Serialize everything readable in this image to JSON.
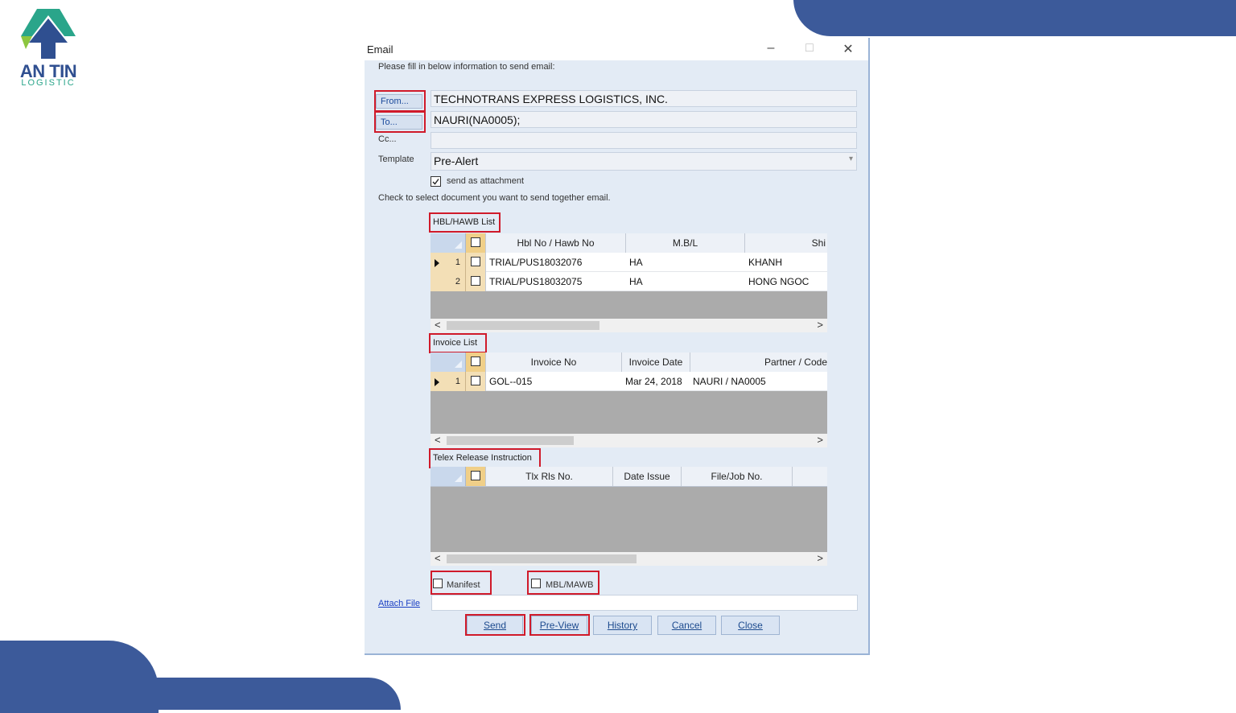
{
  "brand": {
    "name": "AN TIN",
    "tagline": "LOGISTIC",
    "accent": "#3c5a9a",
    "green": "#2aa58a"
  },
  "window": {
    "title": "Email",
    "minimize": "–",
    "maximize": "□",
    "close": "✕"
  },
  "form": {
    "instruction": "Please fill in below information to send email:",
    "from_label": "From...",
    "from_value": "TECHNOTRANS EXPRESS LOGISTICS, INC.",
    "to_label": "To...",
    "to_value": "NAURI(NA0005);",
    "cc_label": "Cc...",
    "cc_value": "",
    "template_label": "Template",
    "template_value": "Pre-Alert",
    "attachment_label": "send as attachment",
    "check_instruction": "Check to select document you want to send together email."
  },
  "hbl": {
    "caption": "HBL/HAWB List",
    "columns": [
      "Hbl No / Hawb No",
      "M.B/L",
      "Shi"
    ],
    "rows": [
      {
        "num": "1",
        "hbl": "TRIAL/PUS18032076",
        "mbl": "HA",
        "shipper": "KHANH"
      },
      {
        "num": "2",
        "hbl": "TRIAL/PUS18032075",
        "mbl": "HA",
        "shipper": "HONG NGOC"
      }
    ]
  },
  "invoice": {
    "caption": "Invoice List",
    "columns": [
      "Invoice No",
      "Invoice Date",
      "Partner / Code"
    ],
    "rows": [
      {
        "num": "1",
        "no": "GOL--015",
        "date": "Mar 24, 2018",
        "partner": "NAURI / NA0005"
      }
    ]
  },
  "telex": {
    "caption": "Telex Release Instruction",
    "columns": [
      "Tlx Rls No.",
      "Date Issue",
      "File/Job No."
    ]
  },
  "scroll": {
    "left": "<",
    "right": ">"
  },
  "options": {
    "manifest": "Manifest",
    "mbl": "MBL/MAWB"
  },
  "attach": {
    "label": "Attach File",
    "value": ""
  },
  "buttons": {
    "send": "Send",
    "preview": "Pre-View",
    "history": "History",
    "cancel": "Cancel",
    "close": "Close"
  }
}
